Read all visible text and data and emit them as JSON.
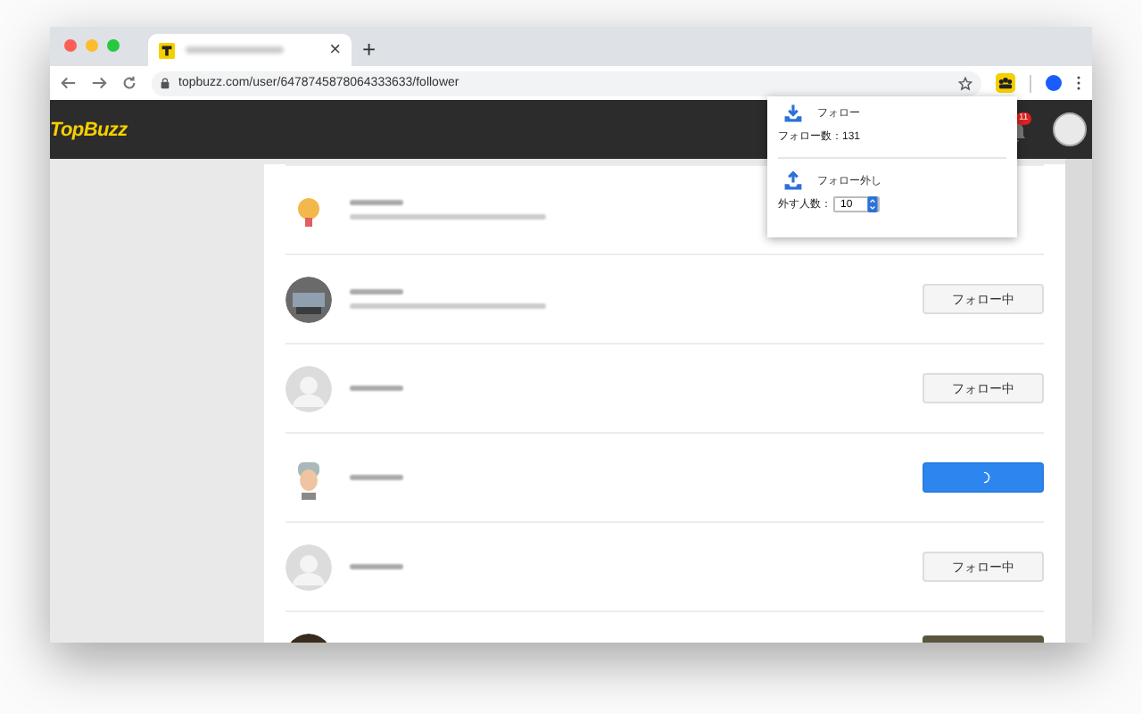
{
  "browser": {
    "tab_close": "×",
    "new_tab": "+",
    "url": "topbuzz.com/user/6478745878064333633/follower"
  },
  "site": {
    "logo": "TopBuzz",
    "notifications": "11"
  },
  "popup": {
    "follow_label": "フォロー",
    "follow_count": "フォロー数：131",
    "unfollow_label": "フォロー外し",
    "amount_label": "外す人数：",
    "amount": "10"
  },
  "rows": [
    {
      "avatar": {
        "kind": "emoji"
      },
      "has_bio": true
    },
    {
      "avatar": {
        "kind": "photo"
      },
      "has_bio": true,
      "button": {
        "kind": "following",
        "label": "フォロー中"
      }
    },
    {
      "avatar": {
        "kind": "default"
      },
      "has_bio": false,
      "button": {
        "kind": "following",
        "label": "フォロー中"
      }
    },
    {
      "avatar": {
        "kind": "cartoon"
      },
      "has_bio": false,
      "button": {
        "kind": "loading"
      }
    },
    {
      "avatar": {
        "kind": "default"
      },
      "has_bio": false,
      "button": {
        "kind": "following",
        "label": "フォロー中"
      }
    },
    {
      "avatar": {
        "kind": "dark-photo"
      },
      "has_bio": false,
      "button": {
        "kind": "dark"
      }
    }
  ]
}
